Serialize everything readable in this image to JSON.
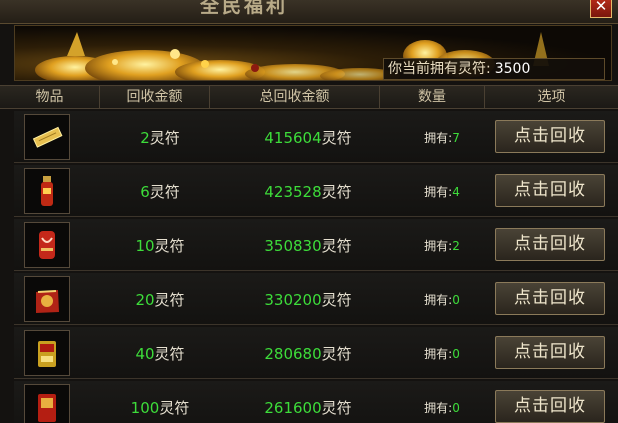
{
  "window": {
    "title": "全民福利",
    "close_label": "✕"
  },
  "balance": {
    "label": "你当前拥有灵符:",
    "value": "3500"
  },
  "table": {
    "headers": [
      "物品",
      "回收金额",
      "总回收金额",
      "数量",
      "选项"
    ],
    "rows": [
      {
        "item_icon": "gold-bar-icon",
        "price_num": "2",
        "unit": "灵符",
        "total_num": "415604",
        "own_label": "拥有:",
        "count": "7",
        "action": "点击回收"
      },
      {
        "item_icon": "red-vial-icon",
        "price_num": "6",
        "unit": "灵符",
        "total_num": "423528",
        "own_label": "拥有:",
        "count": "4",
        "action": "点击回收"
      },
      {
        "item_icon": "red-scroll-icon",
        "price_num": "10",
        "unit": "灵符",
        "total_num": "350830",
        "own_label": "拥有:",
        "count": "2",
        "action": "点击回收"
      },
      {
        "item_icon": "red-pouch-icon",
        "price_num": "20",
        "unit": "灵符",
        "total_num": "330200",
        "own_label": "拥有:",
        "count": "0",
        "action": "点击回收"
      },
      {
        "item_icon": "gold-box-icon",
        "price_num": "40",
        "unit": "灵符",
        "total_num": "280680",
        "own_label": "拥有:",
        "count": "0",
        "action": "点击回收"
      },
      {
        "item_icon": "red-box-icon",
        "price_num": "100",
        "unit": "灵符",
        "total_num": "261600",
        "own_label": "拥有:",
        "count": "0",
        "action": "点击回收"
      }
    ]
  },
  "colors": {
    "accent_green": "#3ddc3a",
    "gold": "#e0b030"
  }
}
